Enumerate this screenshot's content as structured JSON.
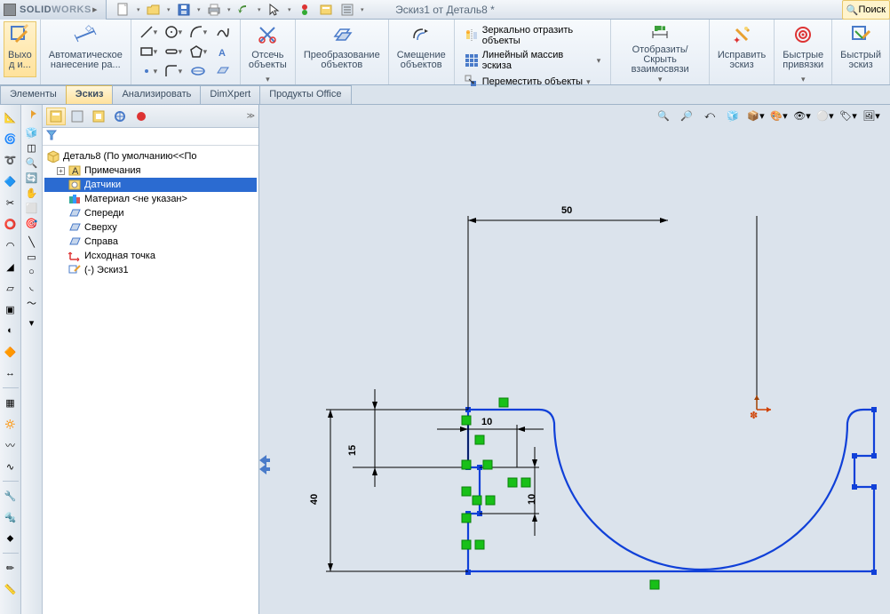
{
  "app": {
    "name_prefix": "SOLID",
    "name_suffix": "WORKS"
  },
  "title": "Эскиз1 от Деталь8 *",
  "search": {
    "label": "Поиск"
  },
  "ribbon": {
    "exit": "Выхо\nд и...",
    "autodim": "Автоматическое\nнанесение ра...",
    "trim": "Отсечь\nобъекты",
    "convert": "Преобразование\nобъектов",
    "offset": "Смещение\nобъектов",
    "mirror": "Зеркально отразить объекты",
    "pattern": "Линейный массив эскиза",
    "move": "Переместить объекты",
    "showhide": "Отобразить/Скрыть\nвзаимосвязи",
    "repair": "Исправить\nэскиз",
    "quicksnaps": "Быстрые\nпривязки",
    "rapidsketch": "Быстрый\nэскиз"
  },
  "tabs": {
    "features": "Элементы",
    "sketch": "Эскиз",
    "evaluate": "Анализировать",
    "dimxpert": "DimXpert",
    "office": "Продукты Office"
  },
  "tree": {
    "root": "Деталь8  (По умолчанию<<По",
    "annotations": "Примечания",
    "sensors": "Датчики",
    "material": "Материал <не указан>",
    "front": "Спереди",
    "top": "Сверху",
    "right": "Справа",
    "origin": "Исходная точка",
    "sketch1": "(-) Эскиз1"
  },
  "dims": {
    "d50": "50",
    "d40": "40",
    "d15": "15",
    "d10a": "10",
    "d10b": "10"
  }
}
